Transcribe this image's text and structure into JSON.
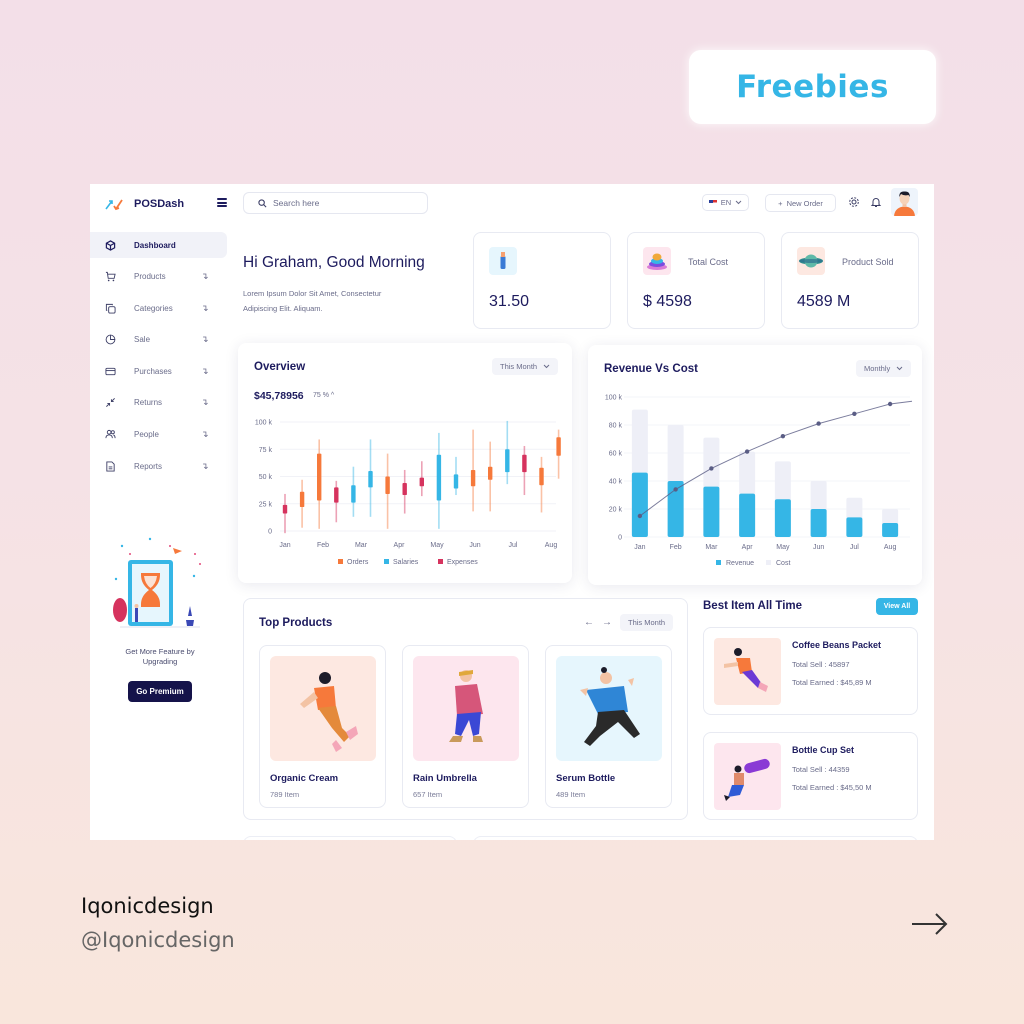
{
  "badge": {
    "label": "Freebies"
  },
  "app": {
    "logo_text": "POSDash",
    "search": {
      "placeholder": "Search here"
    },
    "language": "EN",
    "new_order_label": "New Order",
    "icons": {
      "settings": "gear-icon",
      "notifications": "bell-icon"
    }
  },
  "sidebar": {
    "items": [
      {
        "label": "Dashboard",
        "icon": "box-icon",
        "active": true
      },
      {
        "label": "Products",
        "icon": "cart-icon"
      },
      {
        "label": "Categories",
        "icon": "copy-icon"
      },
      {
        "label": "Sale",
        "icon": "pie-icon"
      },
      {
        "label": "Purchases",
        "icon": "card-icon"
      },
      {
        "label": "Returns",
        "icon": "minimize-icon"
      },
      {
        "label": "People",
        "icon": "users-icon"
      },
      {
        "label": "Reports",
        "icon": "file-icon"
      }
    ],
    "arrow": "↴",
    "promo": {
      "text": "Get More Feature by Upgrading",
      "button": "Go Premium"
    }
  },
  "greeting": {
    "title": "Hi Graham, Good Morning",
    "subtitle": "Lorem Ipsum Dolor Sit Amet, Consectetur Adipiscing Elit. Aliquam."
  },
  "stats": [
    {
      "label": "",
      "value": "31.50",
      "icon": "bottle-icon"
    },
    {
      "label": "Total Cost",
      "value": "$ 4598",
      "icon": "stack-icon"
    },
    {
      "label": "Product Sold",
      "value": "4589 M",
      "icon": "planet-icon"
    }
  ],
  "overview": {
    "title": "Overview",
    "period": "This Month",
    "total": "$45,78956",
    "change": "75 % ^"
  },
  "revenue_cost": {
    "title": "Revenue Vs Cost",
    "period": "Monthly"
  },
  "chart_data": [
    {
      "type": "candlestick",
      "title": "Overview",
      "ylim": [
        0,
        100
      ],
      "yticks": [
        "0",
        "25 k",
        "50 k",
        "75 k",
        "100 k"
      ],
      "categories": [
        "Jan",
        "Feb",
        "Mar",
        "Apr",
        "May",
        "Jun",
        "Jul",
        "Aug"
      ],
      "legend": [
        "Orders",
        "Salaries",
        "Expenses"
      ],
      "legend_position": "bottom",
      "colors": {
        "Orders": "#f6793b",
        "Salaries": "#35b6e6",
        "Expenses": "#d6335e"
      },
      "candles": [
        {
          "x": 0.0,
          "series": "Expenses",
          "low": -2,
          "open": 16,
          "close": 24,
          "high": 34
        },
        {
          "x": 0.45,
          "series": "Orders",
          "low": 3,
          "open": 22,
          "close": 36,
          "high": 47
        },
        {
          "x": 0.9,
          "series": "Orders",
          "low": 2,
          "open": 28,
          "close": 71,
          "high": 84
        },
        {
          "x": 1.35,
          "series": "Expenses",
          "low": 8,
          "open": 26,
          "close": 40,
          "high": 46
        },
        {
          "x": 1.8,
          "series": "Salaries",
          "low": 13,
          "open": 26,
          "close": 42,
          "high": 59
        },
        {
          "x": 2.25,
          "series": "Salaries",
          "low": 13,
          "open": 40,
          "close": 55,
          "high": 84
        },
        {
          "x": 2.7,
          "series": "Orders",
          "low": 2,
          "open": 34,
          "close": 50,
          "high": 71
        },
        {
          "x": 3.15,
          "series": "Expenses",
          "low": 16,
          "open": 33,
          "close": 44,
          "high": 56
        },
        {
          "x": 3.6,
          "series": "Expenses",
          "low": 32,
          "open": 41,
          "close": 49,
          "high": 64
        },
        {
          "x": 4.05,
          "series": "Salaries",
          "low": 2,
          "open": 28,
          "close": 70,
          "high": 90
        },
        {
          "x": 4.5,
          "series": "Salaries",
          "low": 33,
          "open": 39,
          "close": 52,
          "high": 68
        },
        {
          "x": 4.95,
          "series": "Orders",
          "low": 18,
          "open": 41,
          "close": 56,
          "high": 93
        },
        {
          "x": 5.4,
          "series": "Orders",
          "low": 18,
          "open": 47,
          "close": 59,
          "high": 82
        },
        {
          "x": 5.85,
          "series": "Salaries",
          "low": 43,
          "open": 54,
          "close": 75,
          "high": 101
        },
        {
          "x": 6.3,
          "series": "Expenses",
          "low": 33,
          "open": 54,
          "close": 70,
          "high": 78
        },
        {
          "x": 6.75,
          "series": "Orders",
          "low": 17,
          "open": 42,
          "close": 58,
          "high": 68
        },
        {
          "x": 7.2,
          "series": "Orders",
          "low": 48,
          "open": 69,
          "close": 86,
          "high": 93
        }
      ]
    },
    {
      "type": "bar",
      "title": "Revenue Vs Cost",
      "ylim": [
        0,
        100
      ],
      "yticks": [
        "0",
        "20 k",
        "40 k",
        "60 k",
        "80 k",
        "100 k"
      ],
      "categories": [
        "Jan",
        "Feb",
        "Mar",
        "Apr",
        "May",
        "Jun",
        "Jul",
        "Aug"
      ],
      "legend_position": "bottom",
      "series": [
        {
          "name": "Revenue",
          "color": "#35b6e6",
          "values": [
            46,
            40,
            36,
            31,
            27,
            20,
            14,
            10
          ]
        },
        {
          "name": "Cost",
          "color": "#eeeff7",
          "values": [
            91,
            80,
            71,
            61,
            54,
            40,
            28,
            20
          ]
        },
        {
          "name": "Trend",
          "type": "line",
          "color": "#5a5d85",
          "values": [
            15,
            34,
            49,
            61,
            72,
            81,
            88,
            95
          ]
        }
      ]
    }
  ],
  "top_products": {
    "title": "Top Products",
    "period": "This Month",
    "items": [
      {
        "name": "Organic Cream",
        "count": "789 Item",
        "bg": "#fde8e1"
      },
      {
        "name": "Rain Umbrella",
        "count": "657 Item",
        "bg": "#fde6ee"
      },
      {
        "name": "Serum Bottle",
        "count": "489 Item",
        "bg": "#e6f6fd"
      }
    ]
  },
  "best_items": {
    "title": "Best Item All Time",
    "view_all": "View All",
    "items": [
      {
        "name": "Coffee Beans Packet",
        "total_sell": "Total Sell : 45897",
        "total_earned": "Total Earned : $45,89 M",
        "bg": "#fde8e1"
      },
      {
        "name": "Bottle Cup Set",
        "total_sell": "Total Sell : 44359",
        "total_earned": "Total Earned : $45,50 M",
        "bg": "#fde6ee"
      }
    ]
  },
  "footer": {
    "brand": "Iqonicdesign",
    "handle": "@Iqonicdesign"
  }
}
